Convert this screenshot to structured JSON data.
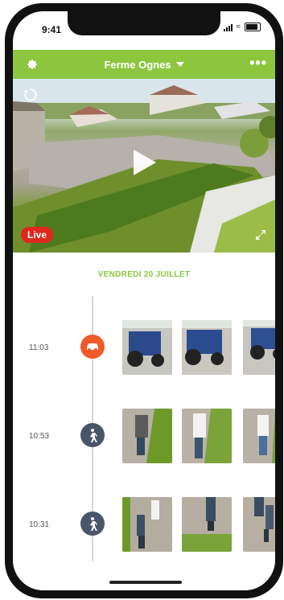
{
  "status": {
    "time": "9:41"
  },
  "header": {
    "title": "Ferme Ognes",
    "more": "•••"
  },
  "video": {
    "live_label": "Live"
  },
  "timeline": {
    "date": "VENDREDI 20 JUILLET",
    "events": [
      {
        "time": "11:03",
        "type": "car",
        "icon_color": "#f05a28"
      },
      {
        "time": "10:53",
        "type": "person",
        "icon_color": "#48556a"
      },
      {
        "time": "10:31",
        "type": "person",
        "icon_color": "#48556a"
      }
    ]
  },
  "colors": {
    "brand_green": "#8cc63f",
    "live_red": "#e1261c",
    "car_orange": "#f05a28",
    "person_slate": "#48556a"
  }
}
